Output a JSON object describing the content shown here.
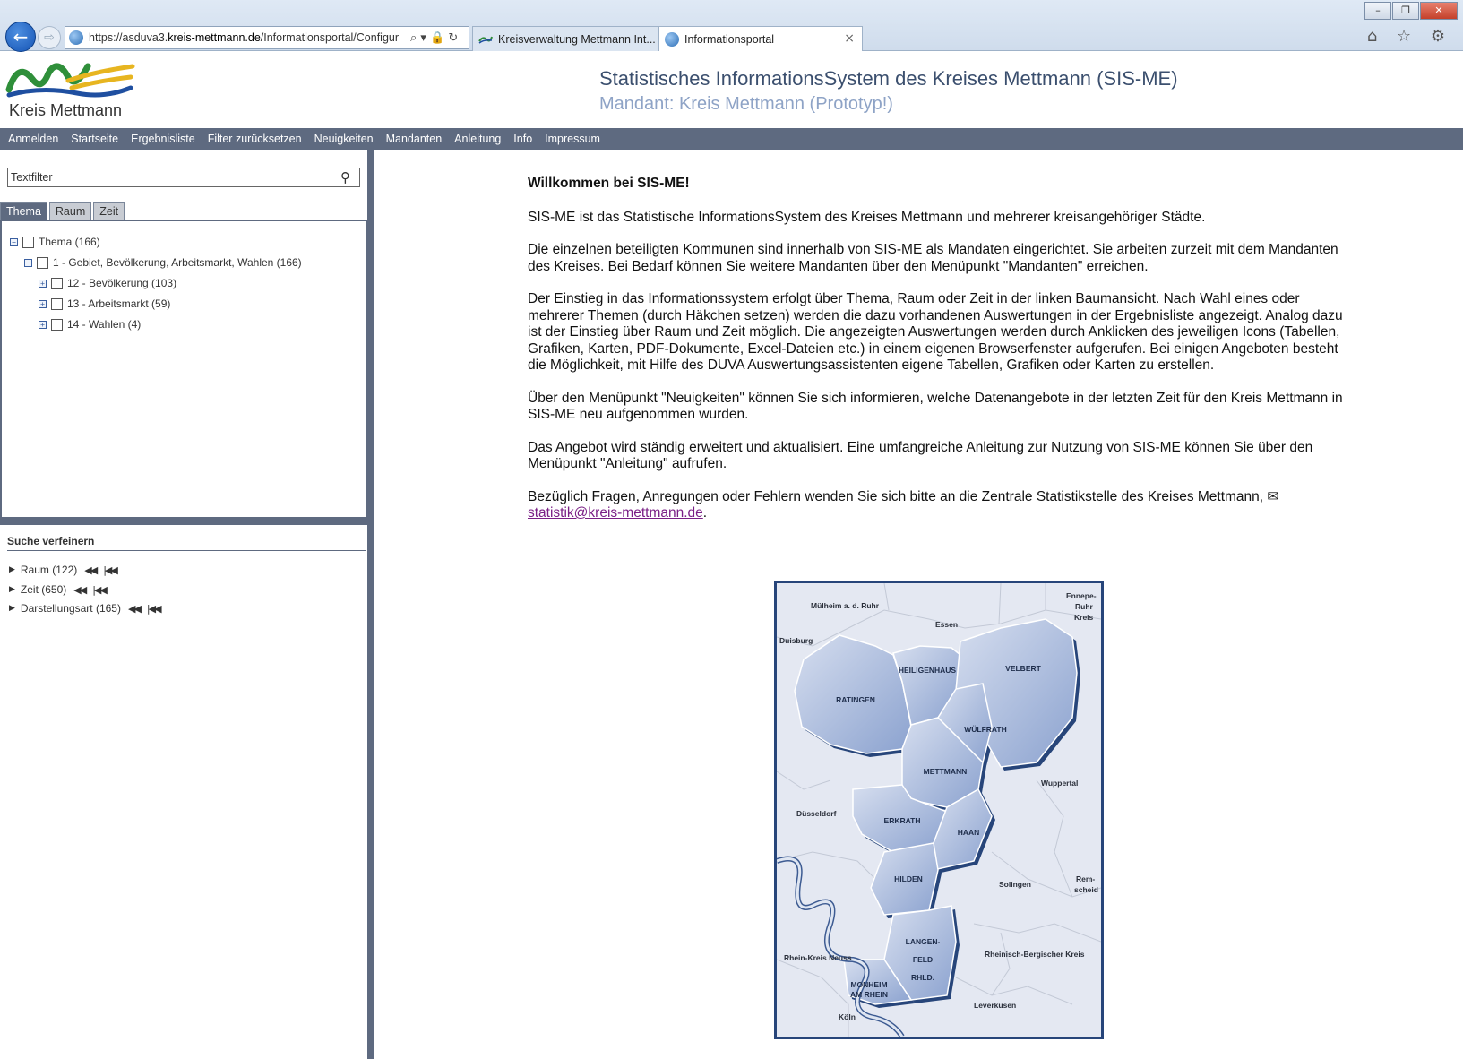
{
  "browser": {
    "url_prefix": "https://asduva3.",
    "url_domain": "kreis-mettmann.de",
    "url_suffix": "/Informationsportal/Configur",
    "tabs": [
      {
        "label": "Kreisverwaltung Mettmann Int..."
      },
      {
        "label": "Informationsportal"
      }
    ],
    "addr_icons": "⌕ ▾ 🔒 ↻",
    "back_icon": "back-arrow-icon",
    "forward_icon": "forward-arrow-icon",
    "toolbar_icons": "⌂ ☆ ⚙",
    "window_controls": [
      "–",
      "❐",
      "✕"
    ]
  },
  "header": {
    "logo_text": "Kreis Mettmann",
    "title": "Statistisches InformationsSystem des Kreises Mettmann (SIS-ME)",
    "subtitle": "Mandant: Kreis Mettmann (Prototyp!)"
  },
  "menu": [
    "Anmelden",
    "Startseite",
    "Ergebnisliste",
    "Filter zurücksetzen",
    "Neuigkeiten",
    "Mandanten",
    "Anleitung",
    "Info",
    "Impressum"
  ],
  "left": {
    "textfilter_value": "Textfilter",
    "tabs": [
      "Thema",
      "Raum",
      "Zeit"
    ],
    "active_tab": "Thema",
    "tree": [
      {
        "label": "Thema (166)",
        "expander": "−"
      },
      {
        "label": "1 - Gebiet, Bevölkerung, Arbeitsmarkt, Wahlen (166)",
        "expander": "−"
      },
      {
        "label": "12 - Bevölkerung (103)",
        "expander": "+"
      },
      {
        "label": "13 - Arbeitsmarkt (59)",
        "expander": "+"
      },
      {
        "label": "14 - Wahlen (4)",
        "expander": "+"
      }
    ],
    "refine_title": "Suche verfeinern",
    "refine": [
      {
        "label": "Raum (122)"
      },
      {
        "label": "Zeit (650)"
      },
      {
        "label": "Darstellungsart (165)"
      }
    ]
  },
  "content": {
    "heading": "Willkommen bei SIS-ME!",
    "paragraphs": [
      "SIS-ME ist das Statistische InformationsSystem des Kreises Mettmann und mehrerer kreisangehöriger Städte.",
      "Die einzelnen beteiligten Kommunen sind innerhalb von SIS-ME als Mandaten eingerichtet. Sie arbeiten zurzeit mit dem Mandanten des Kreises. Bei Bedarf können Sie weitere Mandanten über den Menüpunkt \"Mandanten\" erreichen.",
      "Der Einstieg in das Informationssystem erfolgt über Thema, Raum oder Zeit in der linken Baumansicht. Nach Wahl eines oder mehrerer Themen (durch Häkchen setzen) werden die dazu vorhandenen Auswertungen in der Ergebnisliste angezeigt. Analog dazu ist der Einstieg über Raum und Zeit möglich. Die angezeigten Auswertungen werden durch Anklicken des jeweiligen Icons (Tabellen, Grafiken, Karten, PDF-Dokumente, Excel-Dateien etc.) in einem eigenen Browserfenster aufgerufen. Bei einigen Angeboten besteht die Möglichkeit, mit Hilfe des DUVA Auswertungsassistenten eigene Tabellen, Grafiken oder Karten zu erstellen.",
      "Über den Menüpunkt \"Neuigkeiten\" können Sie sich informieren, welche Datenangebote in der letzten Zeit für den Kreis Mettmann in SIS-ME neu aufgenommen wurden.",
      "Das Angebot wird ständig erweitert und aktualisiert. Eine umfangreiche Anleitung zur Nutzung von SIS-ME können Sie über den Menüpunkt \"Anleitung\" aufrufen."
    ],
    "contact_text": "Bezüglich Fragen, Anregungen oder Fehlern wenden Sie sich bitte an die Zentrale Statistikstelle des Kreises Mettmann, ",
    "mail_icon": "✉",
    "email": "statistik@kreis-mettmann.de",
    "email_suffix": "."
  },
  "map": {
    "district_names": [
      "HEILIGENHAUS",
      "VELBERT",
      "RATINGEN",
      "WÜLFRATH",
      "METTMANN",
      "ERKRATH",
      "HAAN",
      "HILDEN",
      "LANGEN-",
      "FELD",
      "RHLD.",
      "MONHEIM",
      "AM RHEIN"
    ],
    "surrounding_names": [
      "Mülheim a. d. Ruhr",
      "Essen",
      "Ennepe-",
      "Ruhr",
      "Kreis",
      "Duisburg",
      "Wuppertal",
      "Düsseldorf",
      "Solingen",
      "Rem-",
      "scheid",
      "Rhein-Kreis Neuss",
      "Rheinisch-Bergischer Kreis",
      "Leverkusen",
      "Köln"
    ],
    "fill_color": "#aebfe0",
    "shadow_color": "#27457a",
    "river_color": "#3d5b92"
  },
  "colors": {
    "menu_bg": "#5e6a80",
    "title": "#3b4f6e",
    "subtitle": "#8ea3c6",
    "link": "#7a1f86"
  }
}
